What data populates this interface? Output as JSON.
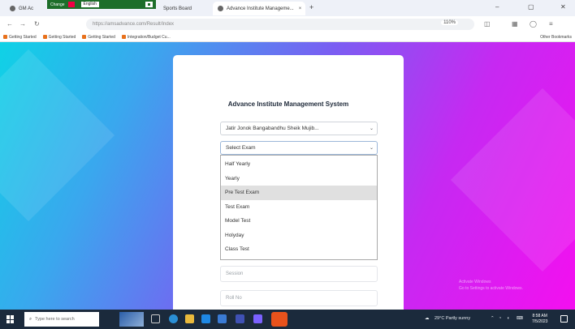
{
  "browser": {
    "tabs": [
      {
        "label": "GM Ac",
        "active": false
      },
      {
        "label": "Sports Board",
        "active": false
      },
      {
        "label": "Advance Institute Manageme...",
        "active": true
      }
    ],
    "overlay": {
      "left_label": "Change",
      "language": "English"
    },
    "new_tab": "+",
    "url": "https://amsadvance.com/Result/Index",
    "zoom": "110%",
    "bookmarks": [
      "Getting Started",
      "Getting Started",
      "Getting Started",
      "Integration/Budget Cu..."
    ],
    "other_bookmarks": "Other Bookmarks"
  },
  "page": {
    "title": "Advance Institute Management System",
    "institute_select": {
      "value": "Jatir Jonok Bangabandhu Sheik Mujib..."
    },
    "exam_select": {
      "value": "Select Exam",
      "options": [
        "Half Yearly",
        "Yearly",
        "Pre Test Exam",
        "Test Exam",
        "Model Test",
        "Holyday",
        "Class Test"
      ],
      "highlighted": "Pre Test Exam"
    },
    "session_field": {
      "placeholder": "Session"
    },
    "roll_field": {
      "placeholder": "Roll No"
    },
    "watermark": [
      "Activate Windows",
      "Go to Settings to activate Windows."
    ]
  },
  "taskbar": {
    "search_placeholder": "Type here to search",
    "weather": "29°C Partly sunny",
    "time": "8:58 AM",
    "date": "7/5/2023"
  },
  "colors": {
    "gradient_start": "#0fd2e6",
    "gradient_end": "#f40ff0",
    "taskbar": "#1b2a3c",
    "highlight": "#e0e0e0"
  }
}
